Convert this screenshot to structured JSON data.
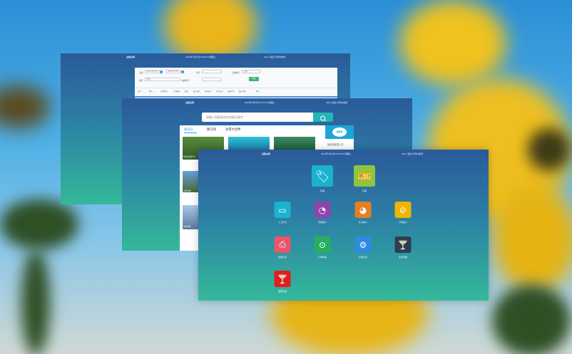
{
  "background": {
    "petal_color": "#f2c21a",
    "leaf_color": "#2f4f25",
    "sky_color": "#3aa3e0"
  },
  "window_back": {
    "title_brand": "证照总表",
    "title_date": "2021年7月26日 09:30:34 星期二",
    "title_user": "Wey1  退出  引导位新用",
    "filters": {
      "date_label": "日期:",
      "date_from": "2021-07-26",
      "date_to": "2021-07-26",
      "ticket_label": "票号:",
      "type_label": "类型:",
      "type_value": "所有",
      "status_label": "日期类型:",
      "status_value": "全部",
      "code_label": "编票机号:",
      "query_button": "查询"
    },
    "table_headers": [
      "序号",
      "票号",
      "日期时间",
      "订单编号",
      "类型",
      "客人姓名",
      "身份证号",
      "支付方式",
      "日期订单",
      "窗口号码",
      "票号"
    ]
  },
  "window_mid": {
    "title_brand": "证照总表",
    "title_date": "2021年7月26日 09:30:34 星期二",
    "title_user": "Wey1  退出  引导位新用",
    "search_placeholder": "请输入您要查询的游客关键字",
    "tabs": [
      {
        "label": "通证证"
      },
      {
        "label": "跑马场"
      },
      {
        "label": "冰雪大世界"
      }
    ],
    "cards": [
      {
        "caption": "鹭岛泊舍里1号"
      },
      {
        "caption": "冰雪世界"
      },
      {
        "caption": "冰雪世界"
      }
    ],
    "side_logo": "旅游票",
    "side_text": "请点击会员入口"
  },
  "window_front": {
    "title_brand": "证照总表",
    "title_date": "2021年7月26日 09:30:34 星期二",
    "title_user": "Wey1  退出  引导位新用",
    "tiles": [
      {
        "label": "售票",
        "icon": "ticket-tag-icon",
        "glyph": "🏷",
        "color": "#1ab3cf"
      },
      {
        "label": "售票",
        "icon": "ticket-machine-icon",
        "glyph": "🎫",
        "color": "#8cc63f"
      },
      {
        "label": "人工售卡",
        "icon": "wallet-icon",
        "glyph": "▭",
        "color": "#1ab3cf"
      },
      {
        "label": "售票统计",
        "icon": "pie-chart-icon",
        "glyph": "◔",
        "color": "#8e44ad"
      },
      {
        "label": "售卡统计",
        "icon": "pie-chart-orange-icon",
        "glyph": "◕",
        "color": "#e67e22"
      },
      {
        "label": "订单退订",
        "icon": "order-cancel-icon",
        "glyph": "⊘",
        "color": "#f0b400"
      },
      {
        "label": "检票打印",
        "icon": "print-icon",
        "glyph": "⎙",
        "color": "#e8546b"
      },
      {
        "label": "订单核销",
        "icon": "order-settle-icon",
        "glyph": "⊙",
        "color": "#27ae60"
      },
      {
        "label": "系统设置",
        "icon": "gear-icon",
        "glyph": "⚙",
        "color": "#2d8be0"
      },
      {
        "label": "会员管理",
        "icon": "cocktail-dark-icon",
        "glyph": "🍸",
        "color": "#2c3e50"
      },
      {
        "label": "酒吧管理",
        "icon": "cocktail-red-icon",
        "glyph": "🍸",
        "color": "#e31c1c"
      }
    ]
  }
}
